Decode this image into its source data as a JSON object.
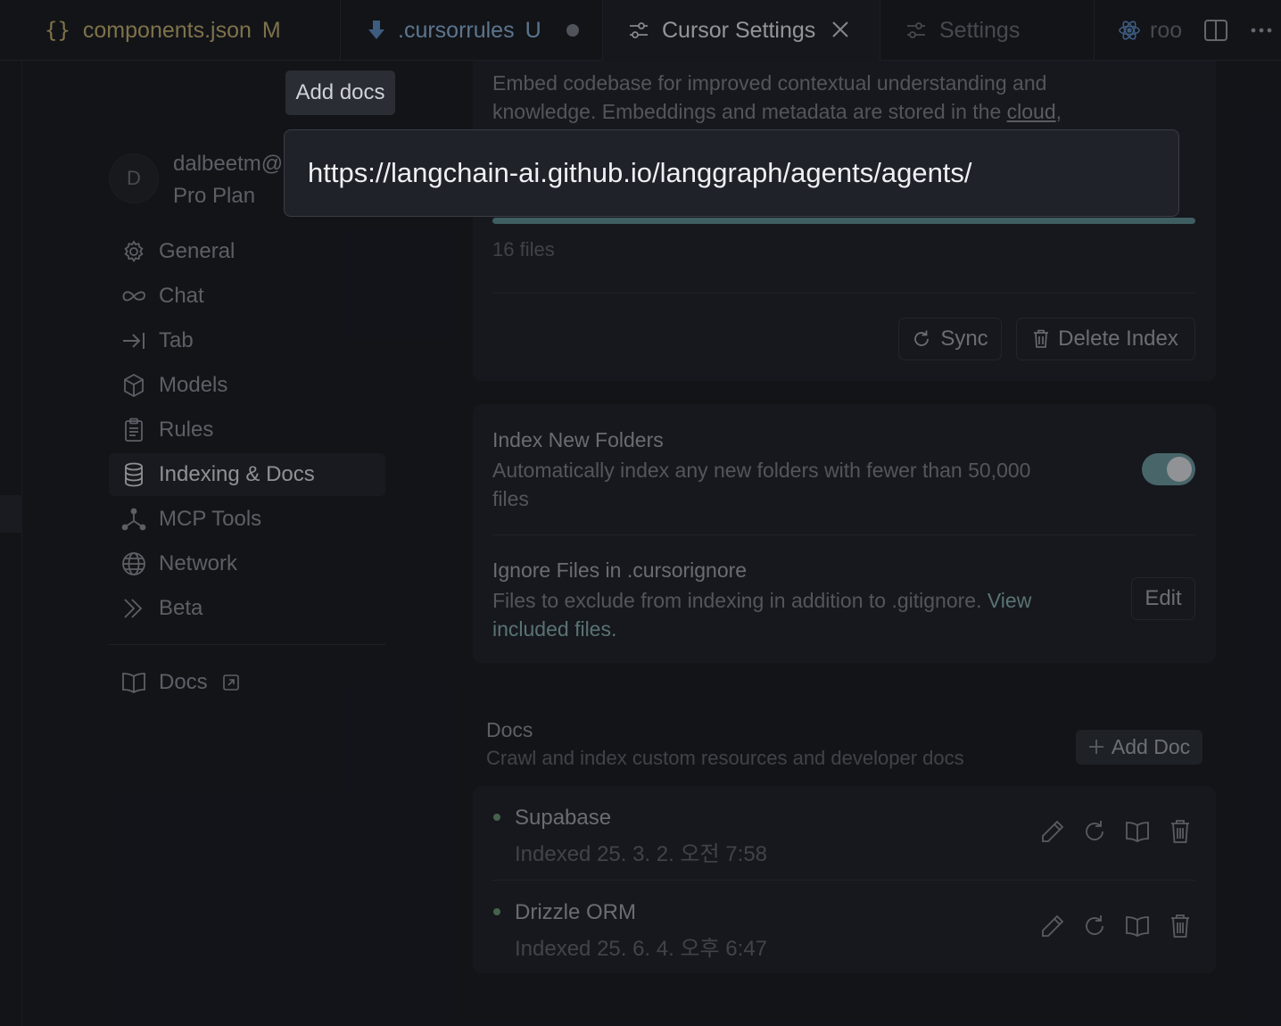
{
  "tabs": [
    {
      "icon": "curly-braces-icon",
      "label": "components.json",
      "badge": "M"
    },
    {
      "icon": "download-arrow-icon",
      "label": ".cursorrules",
      "badge": "U"
    },
    {
      "icon": "sliders-icon",
      "label": "Cursor Settings"
    },
    {
      "icon": "sliders-icon",
      "label": "Settings"
    },
    {
      "icon": "react-atom-icon",
      "label": "roo"
    }
  ],
  "user": {
    "initial": "D",
    "email": "dalbeetm@",
    "plan": "Pro Plan"
  },
  "nav": {
    "items": [
      {
        "icon": "gear-icon",
        "label": "General"
      },
      {
        "icon": "infinity-icon",
        "label": "Chat"
      },
      {
        "icon": "tab-arrow-icon",
        "label": "Tab"
      },
      {
        "icon": "cube-icon",
        "label": "Models"
      },
      {
        "icon": "clipboard-icon",
        "label": "Rules"
      },
      {
        "icon": "database-icon",
        "label": "Indexing & Docs"
      },
      {
        "icon": "nodes-icon",
        "label": "MCP Tools"
      },
      {
        "icon": "globe-icon",
        "label": "Network"
      },
      {
        "icon": "chevrons-icon",
        "label": "Beta"
      }
    ],
    "active": "Indexing & Docs",
    "docs_label": "Docs"
  },
  "codebase": {
    "desc_line1": "Embed codebase for improved contextual understanding and",
    "desc_line2_prefix": "knowledge. Embeddings and metadata are stored in the ",
    "desc_link": "cloud",
    "desc_suffix": ",",
    "progress_percent": 100,
    "files": "16 files",
    "sync_label": "Sync",
    "delete_label": "Delete Index"
  },
  "index_new_folders": {
    "title": "Index New Folders",
    "desc_line1": "Automatically index any new folders with fewer than 50,000",
    "desc_line2": "files",
    "enabled": true
  },
  "ignore_files": {
    "title": "Ignore Files in .cursorignore",
    "desc": "Files to exclude from indexing in addition to .gitignore. ",
    "link_part1": "View",
    "link_part2": "included files.",
    "edit_label": "Edit"
  },
  "docs": {
    "title": "Docs",
    "subtitle": "Crawl and index custom resources and developer docs",
    "add_label": "Add Doc",
    "items": [
      {
        "name": "Supabase",
        "date": "Indexed 25. 3. 2. 오전 7:58"
      },
      {
        "name": "Drizzle ORM",
        "date": "Indexed 25. 6. 4. 오후 6:47"
      }
    ]
  },
  "popup": {
    "tooltip": "Add docs",
    "url": "https://langchain-ai.github.io/langgraph/agents/agents/"
  },
  "colors": {
    "accent": "#6e9ea4",
    "status_dot": "#6b9873",
    "background": "#181a1f",
    "panel": "#1e2127"
  }
}
